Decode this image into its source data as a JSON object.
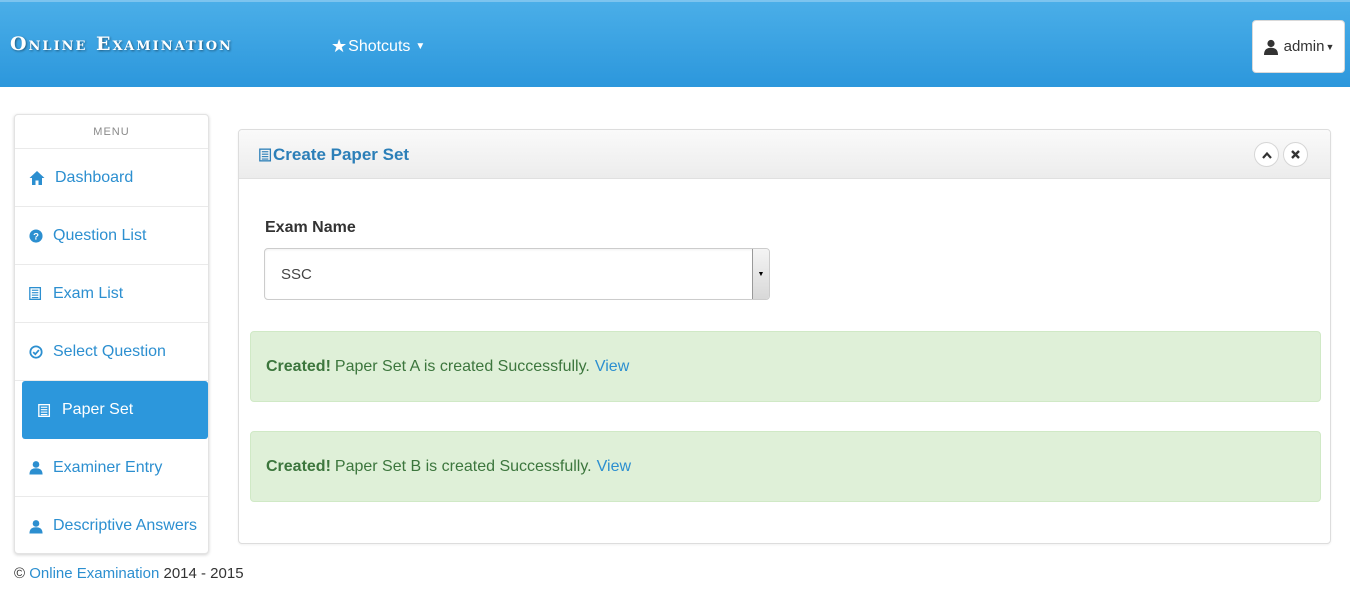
{
  "navbar": {
    "brand": "Online Examination",
    "shortcuts_label": "Shotcuts",
    "user_label": "admin",
    "background_color": "#2c97dc"
  },
  "sidebar": {
    "header": "MENU",
    "items": [
      {
        "label": "Dashboard",
        "icon": "home-icon",
        "active": false
      },
      {
        "label": "Question List",
        "icon": "question-circle-icon",
        "active": false
      },
      {
        "label": "Exam List",
        "icon": "list-document-icon",
        "active": false
      },
      {
        "label": "Select Question",
        "icon": "check-circle-icon",
        "active": false
      },
      {
        "label": "Paper Set",
        "icon": "list-document-icon",
        "active": true
      },
      {
        "label": "Examiner Entry",
        "icon": "user-icon",
        "active": false
      },
      {
        "label": "Descriptive Answers",
        "icon": "user-icon",
        "active": false
      }
    ]
  },
  "panel": {
    "title": "Create Paper Set",
    "title_icon": "list-document-icon",
    "collapse_icon": "chevron-up-icon",
    "close_icon": "close-icon",
    "form": {
      "exam_name_label": "Exam Name",
      "exam_name_value": "SSC"
    },
    "alerts": [
      {
        "strong": "Created!",
        "message": "Paper Set A is created Successfully.",
        "link": "View"
      },
      {
        "strong": "Created!",
        "message": "Paper Set B is created Successfully.",
        "link": "View"
      }
    ]
  },
  "footer": {
    "copyright": "©",
    "link_text": "Online Examination",
    "years": "2014 - 2015"
  },
  "colors": {
    "accent": "#2c97dc",
    "link": "#2c8fd0",
    "alert_bg": "#dff0d8",
    "alert_text": "#3c763d"
  }
}
